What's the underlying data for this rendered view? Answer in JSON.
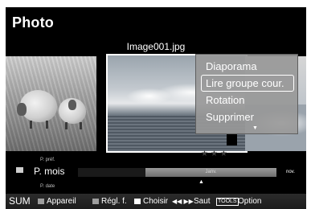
{
  "title": "Photo",
  "filename": "Image001.jpg",
  "tools_menu": {
    "items": [
      "Diaporama",
      "Lire groupe cour.",
      "Rotation",
      "Supprimer"
    ],
    "selected_index": 1
  },
  "rating": "★★★",
  "sort": {
    "prev": "P. préf.",
    "current": "P. mois",
    "next": "P. date"
  },
  "timeline": {
    "current": "Janv.",
    "next": "nov."
  },
  "footer": {
    "sum": "SUM",
    "appareil": "Appareil",
    "regl": "Régl. f.",
    "choisir": "Choisir",
    "saut_arrows": "◀◀ ▶▶",
    "saut": "Saut",
    "tools_badge": "TOOLS",
    "option": "Option"
  },
  "colors": {
    "footer_square": "#9e9e9e",
    "choisir_square": "#ffffff"
  }
}
